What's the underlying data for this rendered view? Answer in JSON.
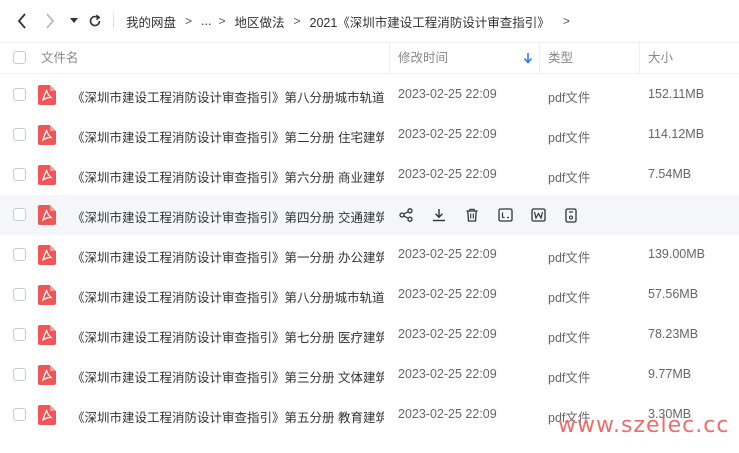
{
  "nav": {
    "back_icon": "chevron-left-icon",
    "forward_icon": "chevron-right-icon",
    "history_icon": "caret-down-icon",
    "refresh_icon": "refresh-icon",
    "breadcrumb": [
      "我的网盘",
      "...",
      "地区做法",
      "2021《深圳市建设工程消防设计审查指引》"
    ],
    "separator": ">"
  },
  "table": {
    "columns": {
      "name": "文件名",
      "modified": "修改时间",
      "type": "类型",
      "size": "大小"
    },
    "sort_icon": "arrow-down-icon",
    "rows": [
      {
        "name": "《深圳市建设工程消防设计审查指引》第八分册城市轨道...",
        "modified": "2023-02-25 22:09",
        "type": "pdf文件",
        "size": "152.11MB"
      },
      {
        "name": "《深圳市建设工程消防设计审查指引》第二分册 住宅建筑...",
        "modified": "2023-02-25 22:09",
        "type": "pdf文件",
        "size": "114.12MB"
      },
      {
        "name": "《深圳市建设工程消防设计审查指引》第六分册 商业建筑...",
        "modified": "2023-02-25 22:09",
        "type": "pdf文件",
        "size": "7.54MB"
      },
      {
        "name": "《深圳市建设工程消防设计审查指引》第四分册 交通建筑...",
        "modified": "",
        "type": "",
        "size": ""
      },
      {
        "name": "《深圳市建设工程消防设计审查指引》第一分册 办公建筑...",
        "modified": "2023-02-25 22:09",
        "type": "pdf文件",
        "size": "139.00MB"
      },
      {
        "name": "《深圳市建设工程消防设计审查指引》第八分册城市轨道...",
        "modified": "2023-02-25 22:09",
        "type": "pdf文件",
        "size": "57.56MB"
      },
      {
        "name": "《深圳市建设工程消防设计审查指引》第七分册 医疗建筑...",
        "modified": "2023-02-25 22:09",
        "type": "pdf文件",
        "size": "78.23MB"
      },
      {
        "name": "《深圳市建设工程消防设计审查指引》第三分册 文体建筑...",
        "modified": "2023-02-25 22:09",
        "type": "pdf文件",
        "size": "9.77MB"
      },
      {
        "name": "《深圳市建设工程消防设计审查指引》第五分册 教育建筑...",
        "modified": "2023-02-25 22:09",
        "type": "pdf文件",
        "size": "3.30MB"
      }
    ],
    "row_actions": [
      "share-icon",
      "download-icon",
      "delete-icon",
      "open-text-icon",
      "open-word-icon",
      "more-file-icon"
    ]
  },
  "watermark": "www.szelec.cc",
  "colors": {
    "pdf_icon": "#f25555",
    "hover_row": "#f4f6fa",
    "sort_arrow": "#2c7cf6",
    "watermark": "#f26b6b"
  }
}
